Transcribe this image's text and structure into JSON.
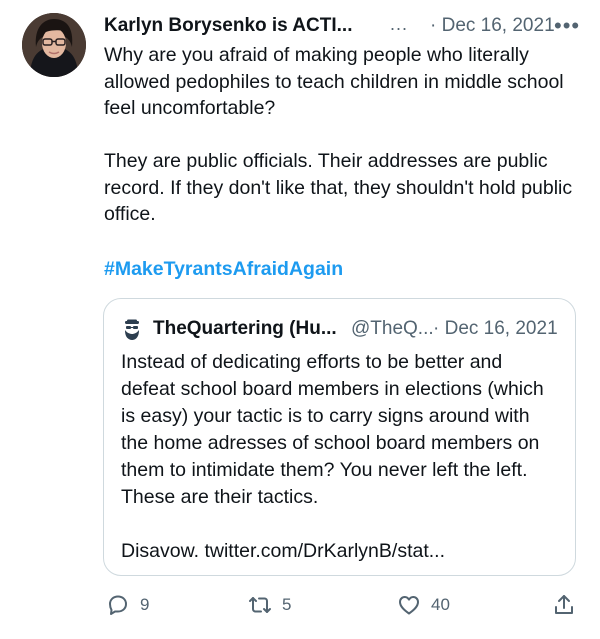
{
  "tweet": {
    "author": {
      "name": "Karlyn Borysenko is ACTI...",
      "handle": "...",
      "avatar": "author-avatar"
    },
    "date": "· Dec 16, 2021",
    "more_icon": "more-icon",
    "paragraphs": [
      "Why are you afraid of making people who literally allowed pedophiles to teach children in middle school feel uncomfortable?",
      "They are public officials. Their addresses are public record. If they don't like that, they shouldn't hold public office."
    ],
    "hashtag": "#MakeTyrantsAfraidAgain",
    "hashtag_color": "#1d9bf0"
  },
  "quote": {
    "author": {
      "name": "TheQuartering (Hu...",
      "handle": "@TheQ...",
      "avatar": "quoted-author-avatar"
    },
    "date": "· Dec 16, 2021",
    "paragraphs": [
      "Instead of dedicating efforts to be better and defeat school board members in elections (which is easy) your tactic is to carry signs around with the home adresses of school board members on them to intimidate them? You never left the left. These are their tactics.",
      "Disavow. twitter.com/DrKarlynB/stat..."
    ]
  },
  "actions": {
    "reply": {
      "icon": "reply-icon",
      "count": "9"
    },
    "retweet": {
      "icon": "retweet-icon",
      "count": "5"
    },
    "like": {
      "icon": "like-icon",
      "count": "40"
    },
    "share": {
      "icon": "share-icon"
    }
  },
  "colors": {
    "text": "#0f1419",
    "secondary": "#536471",
    "link": "#1d9bf0",
    "border": "#cfd9de"
  }
}
